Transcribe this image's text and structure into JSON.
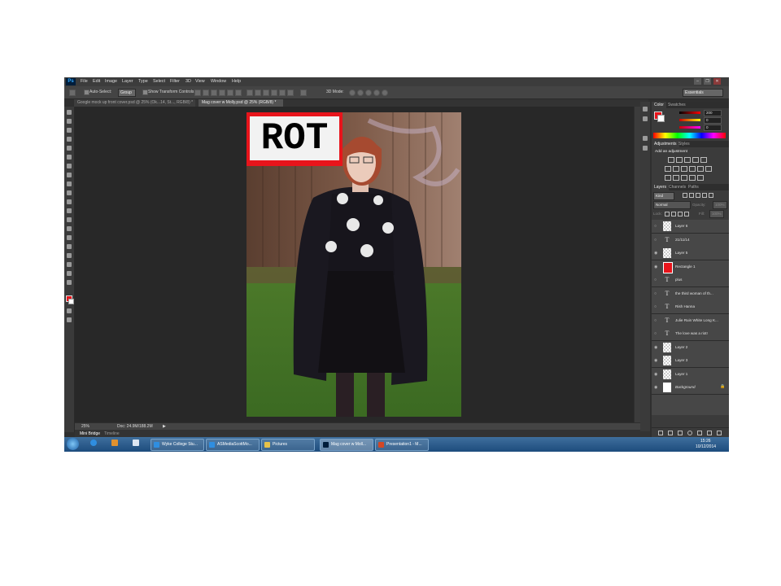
{
  "menubar": {
    "logo": "Ps",
    "items": [
      "File",
      "Edit",
      "Image",
      "Layer",
      "Type",
      "Select",
      "Filter",
      "3D",
      "View",
      "Window",
      "Help"
    ]
  },
  "options": {
    "auto_select": "Auto-Select:",
    "group": "Group",
    "show_transform": "Show Transform Controls",
    "mode_3d": "3D Mode:",
    "workspace": "Essentials"
  },
  "tabs": [
    {
      "label": "Google mock up front cover.psd @ 25% (Ok...14, St..., RGB/8) *",
      "active": false
    },
    {
      "label": "Mag cover w Molly.psd @ 25% (RGB/8) *",
      "active": true
    }
  ],
  "canvas": {
    "masthead": "ROT"
  },
  "status": {
    "zoom": "25%",
    "doc": "Doc: 24.9M/188.2M"
  },
  "bottom_tabs": [
    "Mini Bridge",
    "Timeline"
  ],
  "panels": {
    "color_tabs": [
      "Color",
      "Swatches"
    ],
    "color_values": [
      "200",
      "0",
      "0"
    ],
    "adjust_tabs": [
      "Adjustments",
      "Styles"
    ],
    "adjust_title": "Add an adjustment",
    "layers_tabs": [
      "Layers",
      "Channels",
      "Paths"
    ],
    "kind": "Kind",
    "blend": "Normal",
    "opacity_label": "Opacity:",
    "opacity_value": "100%",
    "lock_label": "Lock:",
    "fill_label": "Fill:",
    "fill_value": "100%"
  },
  "layers": [
    {
      "name": "Layer 6",
      "kind": "raster",
      "visible": false
    },
    {
      "name": "21/11/14",
      "kind": "text",
      "visible": false
    },
    {
      "name": "Layer 5",
      "kind": "raster",
      "visible": true
    },
    {
      "name": "Rectangle 1",
      "kind": "shape",
      "visible": true
    },
    {
      "name": "plus",
      "kind": "text",
      "visible": false
    },
    {
      "name": "the third woman of th...",
      "kind": "text",
      "visible": false
    },
    {
      "name": "Rish Hanna",
      "kind": "text",
      "visible": false
    },
    {
      "name": "Julie Ruin White Long K...",
      "kind": "text",
      "visible": false
    },
    {
      "name": "The love was a riot!",
      "kind": "text",
      "visible": false
    },
    {
      "name": "Layer 2",
      "kind": "raster",
      "visible": true
    },
    {
      "name": "Layer 3",
      "kind": "raster",
      "visible": true
    },
    {
      "name": "Layer 1",
      "kind": "raster",
      "visible": true
    },
    {
      "name": "Background",
      "kind": "background",
      "visible": true
    }
  ],
  "taskbar": {
    "items": [
      {
        "label": "Wyke College Stu...",
        "icon": "ie-icon"
      },
      {
        "label": "ASMediaScottMo...",
        "icon": "ie-icon"
      },
      {
        "label": "Pictures",
        "icon": "folder-icon"
      },
      {
        "label": "Mag cover w Moll...",
        "icon": "photoshop-icon"
      },
      {
        "label": "Presentation1 - M...",
        "icon": "powerpoint-icon"
      }
    ],
    "time": "15:26",
    "date": "10/12/2014"
  },
  "colors": {
    "foreground": "#e8141b",
    "background": "#ffffff",
    "masthead_bg": "#e8141b"
  }
}
